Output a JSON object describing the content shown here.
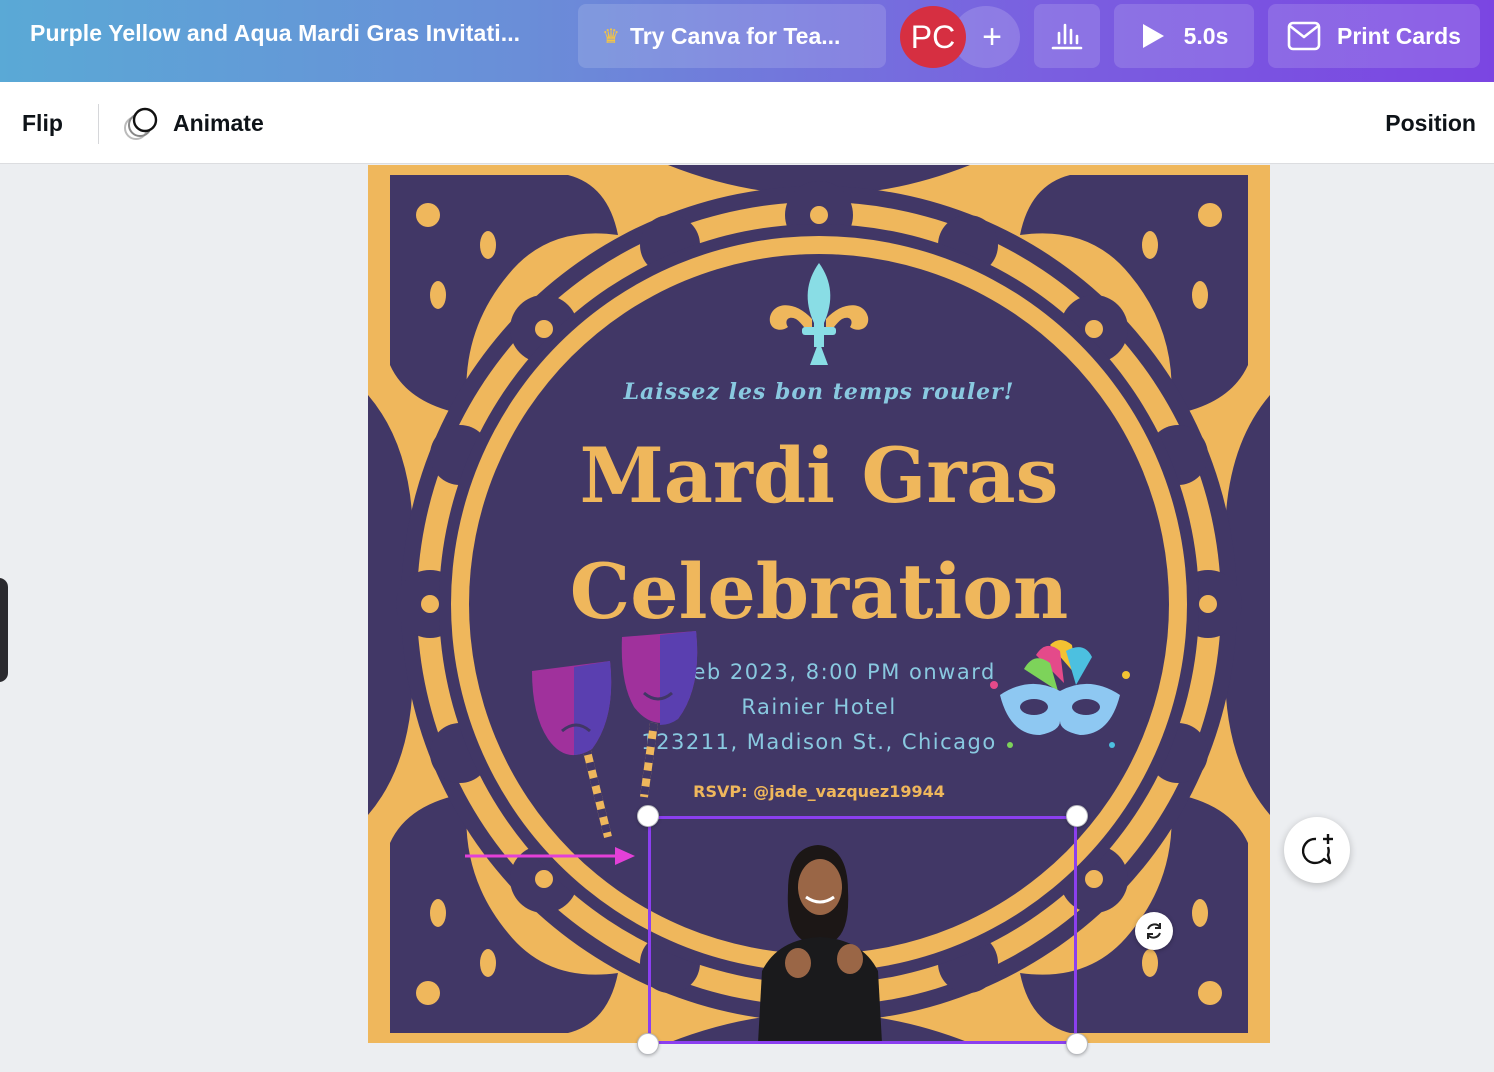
{
  "header": {
    "doc_title": "Purple Yellow and Aqua Mardi Gras Invitati...",
    "try_canva_label": "Try Canva for Tea...",
    "avatar_initials": "PC",
    "plus_label": "+",
    "play_duration": "5.0s",
    "print_label": "Print Cards"
  },
  "toolbar": {
    "flip_label": "Flip",
    "animate_label": "Animate",
    "position_label": "Position"
  },
  "design": {
    "tagline": "Laissez les bon temps rouler!",
    "title_line1": "Mardi Gras",
    "title_line2": "Celebration",
    "date_line": "21 Feb 2023, 8:00 PM onward",
    "venue_line": "Rainier Hotel",
    "address_line": "123211, Madison St., Chicago",
    "rsvp_line": "RSVP: @jade_vazquez19944"
  },
  "colors": {
    "gold": "#efb75c",
    "purple": "#413766",
    "aqua": "#89c9e0",
    "selection": "#8b3ff0",
    "avatar": "#d62f41"
  },
  "icons": [
    "crown-icon",
    "stats-icon",
    "play-icon",
    "print-cards-icon",
    "animate-icon",
    "rotate-icon",
    "add-comment-icon",
    "fleur-de-lis-icon",
    "theater-masks-icon",
    "carnival-mask-icon"
  ]
}
